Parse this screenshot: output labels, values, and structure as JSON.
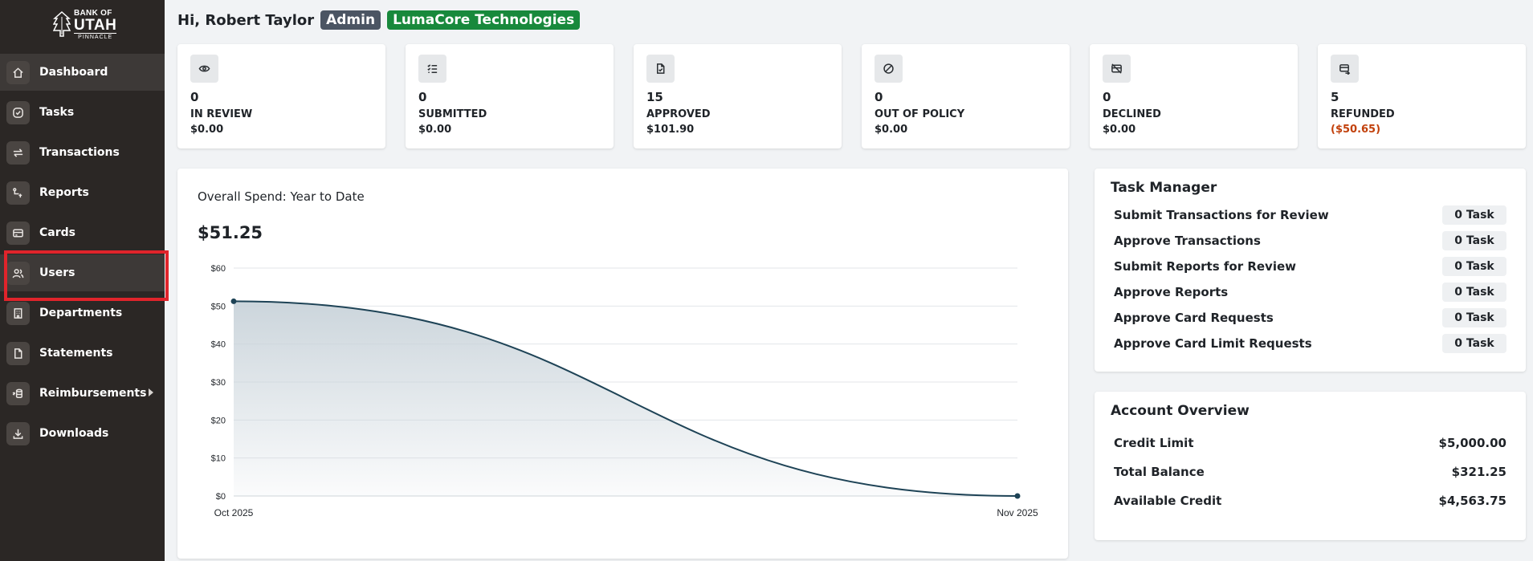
{
  "brand": {
    "line1": "BANK OF",
    "line2": "UTAH",
    "line3": "PINNACLE"
  },
  "sidebar": {
    "items": [
      {
        "label": "Dashboard",
        "icon": "home-icon"
      },
      {
        "label": "Tasks",
        "icon": "check-circle-icon"
      },
      {
        "label": "Transactions",
        "icon": "arrows-swap-icon"
      },
      {
        "label": "Reports",
        "icon": "report-flow-icon"
      },
      {
        "label": "Cards",
        "icon": "credit-card-icon"
      },
      {
        "label": "Users",
        "icon": "users-icon"
      },
      {
        "label": "Departments",
        "icon": "building-icon"
      },
      {
        "label": "Statements",
        "icon": "document-icon"
      },
      {
        "label": "Reimbursements",
        "icon": "coins-icon"
      },
      {
        "label": "Downloads",
        "icon": "download-icon"
      }
    ]
  },
  "header": {
    "greeting": "Hi, Robert Taylor",
    "role_badge": "Admin",
    "company_badge": "LumaCore Technologies"
  },
  "stats": [
    {
      "count": "0",
      "label": "IN REVIEW",
      "amount": "$0.00",
      "icon": "eye-icon"
    },
    {
      "count": "0",
      "label": "SUBMITTED",
      "amount": "$0.00",
      "icon": "checklist-icon"
    },
    {
      "count": "15",
      "label": "APPROVED",
      "amount": "$101.90",
      "icon": "file-check-icon"
    },
    {
      "count": "0",
      "label": "OUT OF POLICY",
      "amount": "$0.00",
      "icon": "ban-icon"
    },
    {
      "count": "0",
      "label": "DECLINED",
      "amount": "$0.00",
      "icon": "card-off-icon"
    },
    {
      "count": "5",
      "label": "REFUNDED",
      "amount": "($50.65)",
      "icon": "card-refund-icon"
    }
  ],
  "spend": {
    "title": "Overall Spend: Year to Date",
    "total": "$51.25"
  },
  "chart_data": {
    "type": "area",
    "x": [
      "Oct 2025",
      "Nov 2025"
    ],
    "values": [
      51.25,
      0
    ],
    "ylim": [
      0,
      60
    ],
    "y_ticks": [
      "$0",
      "$10",
      "$20",
      "$30",
      "$40",
      "$50",
      "$60"
    ],
    "grid": true,
    "line_color": "#1e4356",
    "fill_color": "#c9d3da"
  },
  "task_manager": {
    "title": "Task Manager",
    "rows": [
      {
        "label": "Submit Transactions for Review",
        "value": "0 Task"
      },
      {
        "label": "Approve Transactions",
        "value": "0 Task"
      },
      {
        "label": "Submit Reports for Review",
        "value": "0 Task"
      },
      {
        "label": "Approve Reports",
        "value": "0 Task"
      },
      {
        "label": "Approve Card Requests",
        "value": "0 Task"
      },
      {
        "label": "Approve Card Limit Requests",
        "value": "0 Task"
      }
    ]
  },
  "account_overview": {
    "title": "Account Overview",
    "rows": [
      {
        "label": "Credit Limit",
        "value": "$5,000.00"
      },
      {
        "label": "Total Balance",
        "value": "$321.25"
      },
      {
        "label": "Available Credit",
        "value": "$4,563.75"
      }
    ]
  },
  "colors": {
    "sidebar_bg": "#2b2725",
    "company_badge": "#18893c",
    "admin_badge": "#4b5563",
    "negative": "#c2410c",
    "annotation": "#e0242b"
  }
}
